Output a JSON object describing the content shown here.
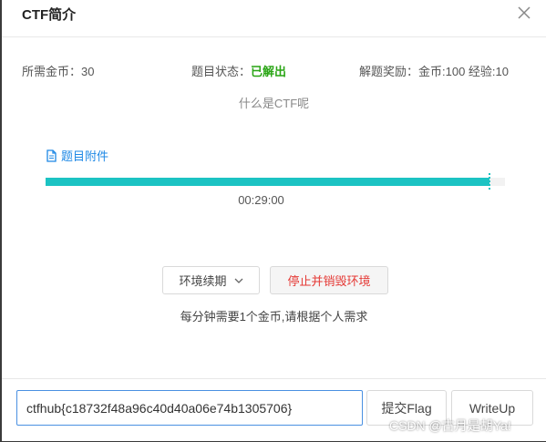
{
  "header": {
    "title": "CTF简介"
  },
  "info": {
    "cost_label": "所需金币：",
    "cost_value": "30",
    "status_label": "题目状态：",
    "status_value": "已解出",
    "reward_label": "解题奖励：",
    "reward_value": "金币:100 经验:10"
  },
  "description": "什么是CTF呢",
  "attachment": {
    "label": "题目附件",
    "icon": "file-icon"
  },
  "progress": {
    "fraction": 0.967,
    "color": "#1cc3c3"
  },
  "timer": "00:29:00",
  "environment": {
    "renew_label": "环境续期",
    "stop_label": "停止并销毁环境",
    "note": "每分钟需要1个金币,请根据个人需求"
  },
  "footer": {
    "flag_value": "ctfhub{c18732f48a96c40d40a06e74b1305706}",
    "submit_label": "提交Flag",
    "writeup_label": "WriteUp"
  },
  "watermark": "CSDN @古月是胡Ya!",
  "colors": {
    "accent": "#1cc3c3",
    "success": "#2aa515",
    "danger": "#e53935",
    "link": "#1e88e5"
  }
}
